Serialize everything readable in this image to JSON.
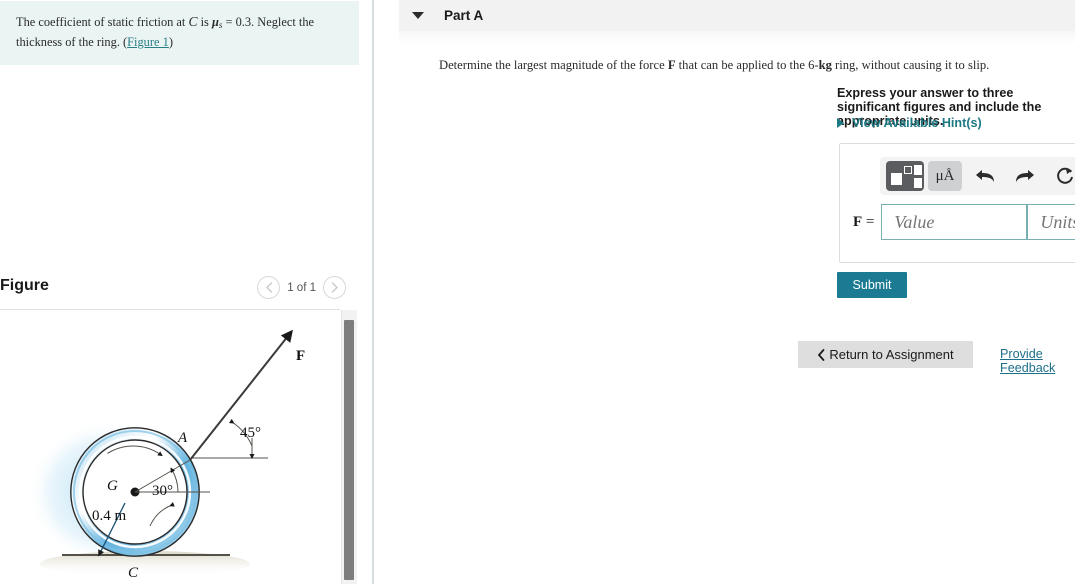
{
  "left": {
    "question": {
      "text_part1": "The coefficient of static friction at ",
      "var_C": "C",
      "text_is": " is ",
      "mu": "μ",
      "mu_sub": "s",
      "value": " = 0.3. Neglect the thickness of the ring. (",
      "link": "Figure 1",
      "close": ")"
    },
    "figure": {
      "title": "Figure",
      "prev_icon": "chevron-left",
      "count": "1 of 1",
      "next_icon": "chevron-right",
      "labels": {
        "force": "F",
        "angle_force": "45°",
        "point_a": "A",
        "center_g": "G",
        "angle_radius": "30°",
        "radius": "0.4 m",
        "contact_c": "C"
      }
    }
  },
  "right": {
    "part_header": {
      "caret_icon": "caret-down-icon",
      "label": "Part A"
    },
    "prompt": {
      "line1_a": "Determine the largest magnitude of the force ",
      "line1_vec": "F",
      "line1_b": " that can be applied to the 6-",
      "line1_kg": "kg",
      "line1_c": " ring, without causing it to slip.",
      "line2": "Express your answer to three significant figures and include the appropriate units."
    },
    "hints": {
      "label": "View Available Hint(s)",
      "caret_icon": "caret-right-icon"
    },
    "toolbar": {
      "template_icon": "math-template-icon",
      "units_label": "μÅ",
      "undo_icon": "undo-arrow-icon",
      "redo_icon": "redo-arrow-icon",
      "reset_icon": "reset-circular-arrow-icon",
      "keyboard_icon": "keyboard-icon",
      "help_label": "?"
    },
    "answer": {
      "symbol": "F",
      "equals": "=",
      "value_placeholder": "Value",
      "units_placeholder": "Units",
      "value": "",
      "units": ""
    },
    "submit_label": "Submit",
    "return_label": "Return to Assignment",
    "return_icon": "chevron-left-icon",
    "feedback_label": "Provide Feedback"
  },
  "colors": {
    "question_bg": "#e9f4f3",
    "accent_teal": "#1d7a84",
    "submit_blue": "#1b7b93",
    "link_blue": "#1d6f8a",
    "ring_blue": "#69b4dd",
    "header_gray": "#f2f2f2"
  }
}
